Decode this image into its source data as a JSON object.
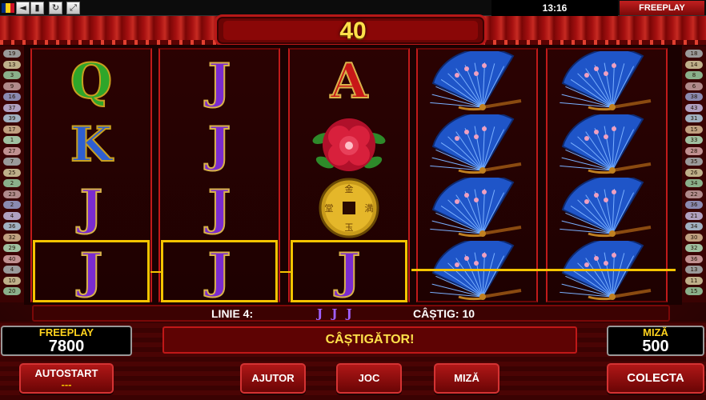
{
  "status_bar": {
    "icons": [
      "sound-icon",
      "mute-icon",
      "window-icon",
      "refresh-icon",
      "expand-icon"
    ],
    "clock": "13:16",
    "mode": "FREEPLAY"
  },
  "header": {
    "win_value": "40"
  },
  "lines_left": [
    "19",
    "13",
    "3",
    "9",
    "16",
    "37",
    "39",
    "17",
    "1",
    "27",
    "7",
    "25",
    "2",
    "23",
    "2",
    "4",
    "36",
    "32",
    "29",
    "40",
    "4",
    "10",
    "20"
  ],
  "lines_right": [
    "18",
    "14",
    "8",
    "6",
    "38",
    "43",
    "31",
    "15",
    "33",
    "28",
    "35",
    "26",
    "34",
    "22",
    "36",
    "21",
    "34",
    "30",
    "32",
    "36",
    "13",
    "11",
    "15"
  ],
  "reels": [
    [
      "Q",
      "K",
      "J",
      "J"
    ],
    [
      "J",
      "J",
      "J",
      "J"
    ],
    [
      "A",
      "flower",
      "coin",
      "J"
    ],
    [
      "fan",
      "fan",
      "fan",
      "fan"
    ],
    [
      "fan",
      "fan",
      "fan",
      "fan"
    ]
  ],
  "info": {
    "line_label": "LINIE 4:",
    "line_symbols": "J J J",
    "win_label": "CÂȘTIG: 10"
  },
  "bottom": {
    "balance_label": "FREEPLAY",
    "balance_value": "7800",
    "message": "CÂȘTIGĂTOR!",
    "bet_label": "MIZĂ",
    "bet_value": "500",
    "autostart_label": "AUTOSTART",
    "autostart_value": "---",
    "help_label": "AJUTOR",
    "game_label": "JOC",
    "bet_button_label": "MIZĂ",
    "collect_label": "COLECTA"
  },
  "colors": {
    "accent_gold": "#ffd31e",
    "reel_red": "#c01a1a",
    "highlight": "#f5c400"
  }
}
